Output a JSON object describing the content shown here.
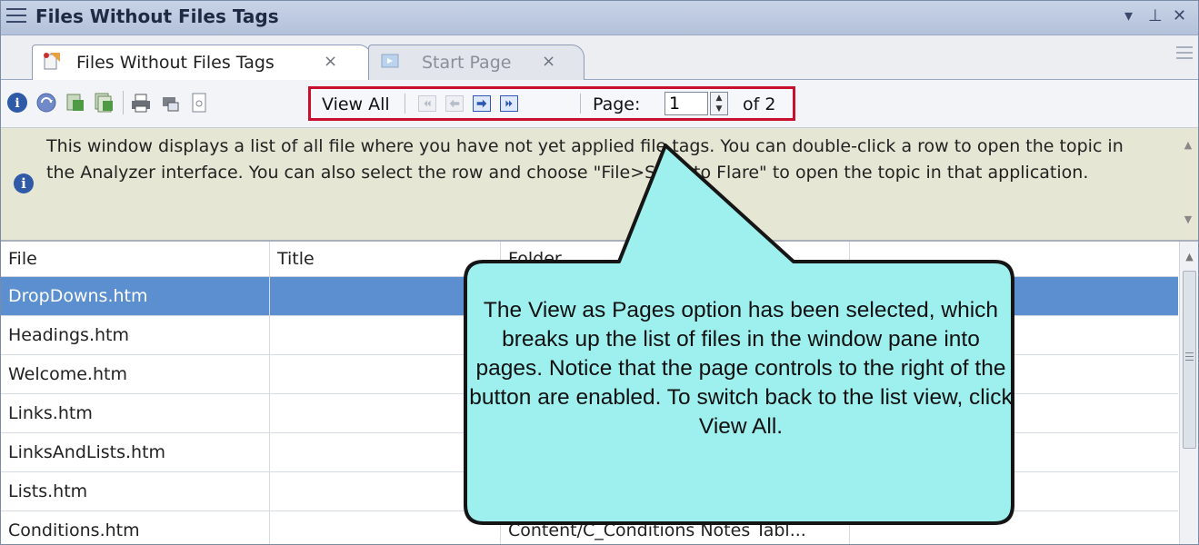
{
  "window": {
    "title": "Files Without Files Tags"
  },
  "tabs": [
    {
      "label": "Files Without Files Tags",
      "close": "×"
    },
    {
      "label": "Start Page",
      "close": "×"
    }
  ],
  "toolbar": {
    "view_all_label": "View All",
    "page_label": "Page:",
    "page_value": "1",
    "page_of": "of 2"
  },
  "info": {
    "text": "This window displays a list of all file where you have not yet applied file tags. You can double-click a row to open the topic in the Analyzer interface. You can also select the row and choose \"File>Send to Flare\" to open the topic in that application."
  },
  "table": {
    "columns": [
      "File",
      "Title",
      "Folder"
    ],
    "rows": [
      {
        "file": "DropDowns.htm",
        "title": "",
        "folder": ""
      },
      {
        "file": "Headings.htm",
        "title": "",
        "folder": ""
      },
      {
        "file": "Welcome.htm",
        "title": "",
        "folder": ""
      },
      {
        "file": "Links.htm",
        "title": "",
        "folder": ""
      },
      {
        "file": "LinksAndLists.htm",
        "title": "",
        "folder": ""
      },
      {
        "file": "Lists.htm",
        "title": "",
        "folder": ""
      },
      {
        "file": "Conditions.htm",
        "title": "",
        "folder": "Content/C_Conditions Notes Tabl..."
      }
    ]
  },
  "callout": {
    "text": "The View as Pages option has been selected, which breaks up the list of files in the window pane into pages. Notice that the page controls to the right of the button are enabled. To switch back to the list view, click View All."
  },
  "colors": {
    "highlight": "#c8102e",
    "callout_fill": "#9ef0ee",
    "selected_row": "#5b8fd0",
    "info_panel": "#e6e6d4"
  }
}
